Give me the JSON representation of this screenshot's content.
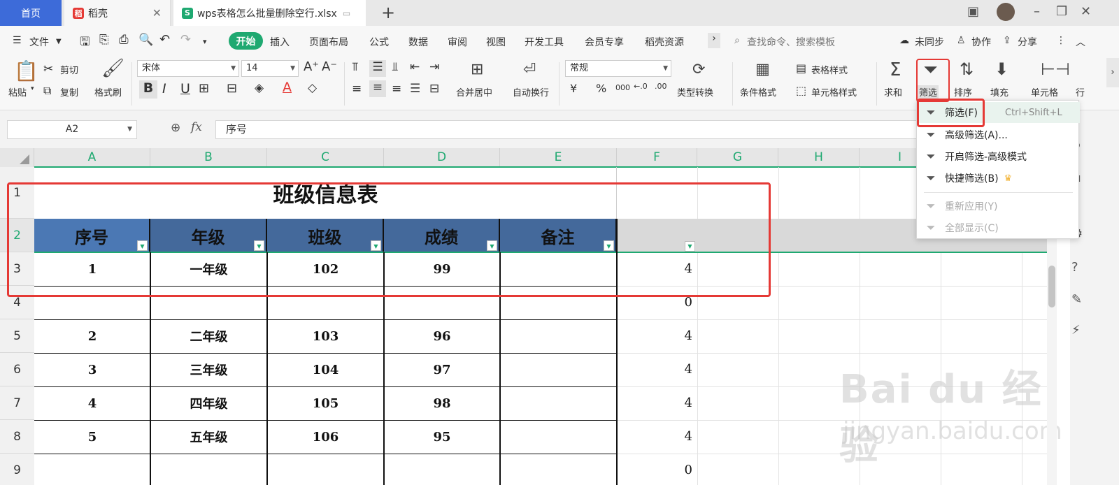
{
  "tabs": {
    "home": "首页",
    "daoke": "稻壳",
    "file": "wps表格怎么批量删除空行.xlsx"
  },
  "menu": {
    "file": "文件",
    "start": "开始",
    "items": [
      "插入",
      "页面布局",
      "公式",
      "数据",
      "审阅",
      "视图",
      "开发工具",
      "会员专享",
      "稻壳资源"
    ],
    "search_placeholder": "查找命令、搜索模板",
    "unsync": "未同步",
    "collab": "协作",
    "share": "分享"
  },
  "ribbon": {
    "paste": "粘贴",
    "cut": "剪切",
    "copy": "复制",
    "format_painter": "格式刷",
    "font": "宋体",
    "font_size": "14",
    "merge": "合并居中",
    "wrap": "自动换行",
    "number_format": "常规",
    "type_convert": "类型转换",
    "cond_format": "条件格式",
    "table_style": "表格样式",
    "cell_style": "单元格样式",
    "sum": "求和",
    "filter": "筛选",
    "sort": "排序",
    "fill": "填充",
    "cell": "单元格",
    "row_col": "行"
  },
  "formula_bar": {
    "name_box": "A2",
    "fx": "fx",
    "content": "序号"
  },
  "columns": [
    "A",
    "B",
    "C",
    "D",
    "E",
    "F",
    "G",
    "H",
    "I"
  ],
  "rows": [
    "1",
    "2",
    "3",
    "4",
    "5",
    "6",
    "7",
    "8",
    "9"
  ],
  "sheet": {
    "title": "班级信息表",
    "headers": [
      "序号",
      "年级",
      "班级",
      "成绩",
      "备注"
    ],
    "data": [
      {
        "a": "1",
        "b": "一年级",
        "c": "102",
        "d": "99",
        "e": "",
        "f": "4"
      },
      {
        "a": "",
        "b": "",
        "c": "",
        "d": "",
        "e": "",
        "f": "0"
      },
      {
        "a": "2",
        "b": "二年级",
        "c": "103",
        "d": "96",
        "e": "",
        "f": "4"
      },
      {
        "a": "3",
        "b": "三年级",
        "c": "104",
        "d": "97",
        "e": "",
        "f": "4"
      },
      {
        "a": "4",
        "b": "四年级",
        "c": "105",
        "d": "98",
        "e": "",
        "f": "4"
      },
      {
        "a": "5",
        "b": "五年级",
        "c": "106",
        "d": "95",
        "e": "",
        "f": "4"
      },
      {
        "a": "",
        "b": "",
        "c": "",
        "d": "",
        "e": "",
        "f": "0"
      }
    ]
  },
  "dropdown": {
    "filter": "筛选(F)",
    "filter_shortcut": "Ctrl+Shift+L",
    "advanced": "高级筛选(A)...",
    "advanced_mode": "开启筛选-高级模式",
    "quick": "快捷筛选(B)",
    "reapply": "重新应用(Y)",
    "show_all": "全部显示(C)"
  },
  "watermark": {
    "main": "Bai du 经验",
    "sub": "jingyan.baidu.com"
  },
  "colors": {
    "accent_green": "#1fa971",
    "header_blue": "#44699b",
    "highlight_red": "#e53935",
    "home_tab_blue": "#3d6bd9"
  }
}
